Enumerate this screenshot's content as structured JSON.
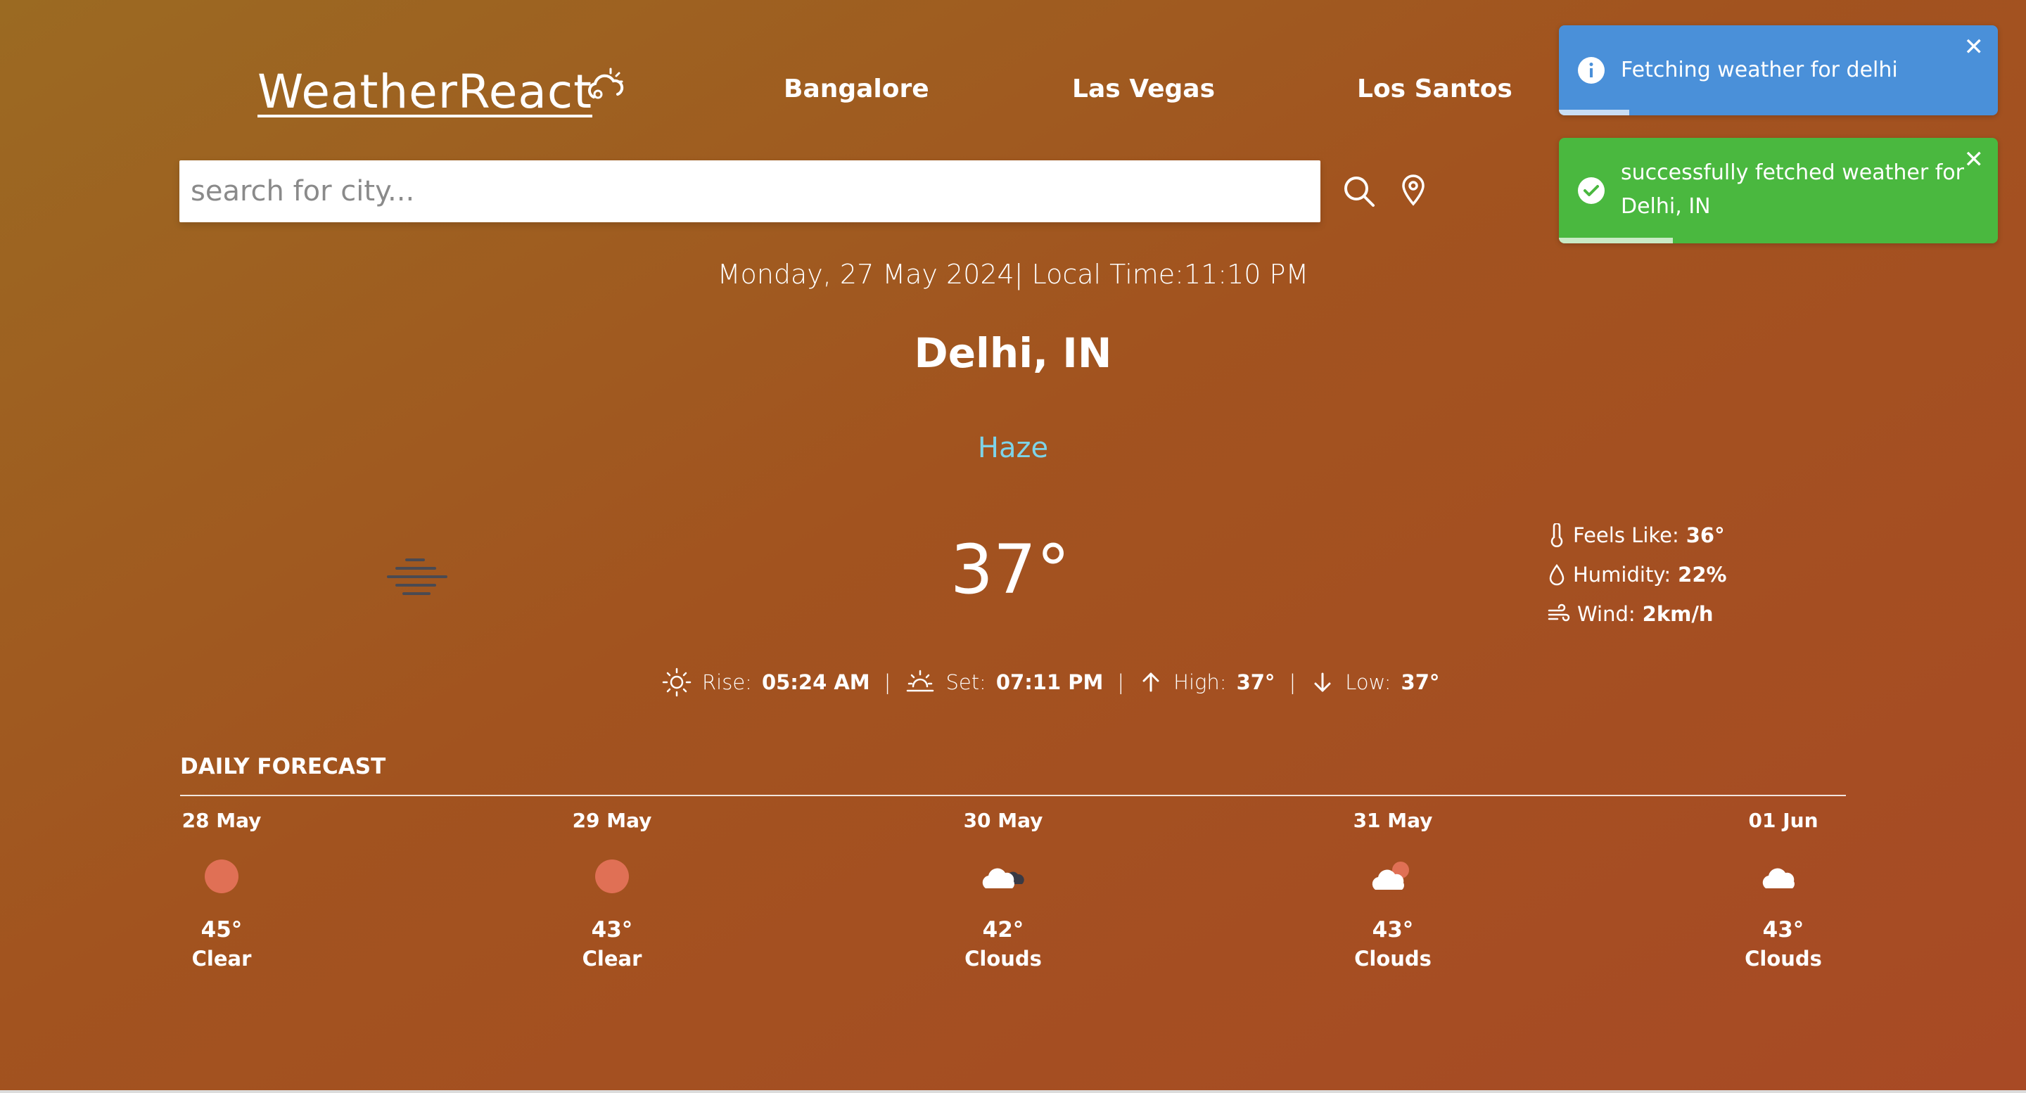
{
  "app": {
    "logo_text": "WeatherReact"
  },
  "nav": {
    "items": [
      "Bangalore",
      "Las Vegas",
      "Los Santos"
    ]
  },
  "search": {
    "placeholder": "search for city..."
  },
  "current": {
    "datetime": "Monday, 27 May 2024| Local Time:11:10 PM",
    "city": "Delhi, IN",
    "condition": "Haze",
    "temperature": "37°",
    "feels_like_label": "Feels Like:",
    "feels_like": "36°",
    "humidity_label": "Humidity:",
    "humidity": "22%",
    "wind_label": "Wind:",
    "wind": "2km/h",
    "rise_label": "Rise:",
    "rise": "05:24 AM",
    "set_label": "Set:",
    "set": "07:11 PM",
    "high_label": "High:",
    "high": "37°",
    "low_label": "Low:",
    "low": "37°",
    "separator": "|"
  },
  "forecast": {
    "title": "DAILY FORECAST",
    "days": [
      {
        "date": "28 May",
        "temp": "45°",
        "desc": "Clear",
        "icon": "sun-icon"
      },
      {
        "date": "29 May",
        "temp": "43°",
        "desc": "Clear",
        "icon": "sun-icon"
      },
      {
        "date": "30 May",
        "temp": "42°",
        "desc": "Clouds",
        "icon": "dark-clouds-icon"
      },
      {
        "date": "31 May",
        "temp": "43°",
        "desc": "Clouds",
        "icon": "sun-cloud-icon"
      },
      {
        "date": "01 Jun",
        "temp": "43°",
        "desc": "Clouds",
        "icon": "cloud-icon"
      }
    ]
  },
  "toasts": [
    {
      "type": "info",
      "message": "Fetching weather for delhi",
      "color": "#4a90d9",
      "progress": 0.16
    },
    {
      "type": "success",
      "message_line1": "successfully fetched weather for",
      "message_line2": "Delhi, IN",
      "color": "#4ab83f",
      "progress": 0.26
    }
  ],
  "colors": {
    "condition": "#7dd3e8",
    "sun": "#e07055",
    "cloud": "#ffffff",
    "haze_icon": "#4a4a52"
  }
}
